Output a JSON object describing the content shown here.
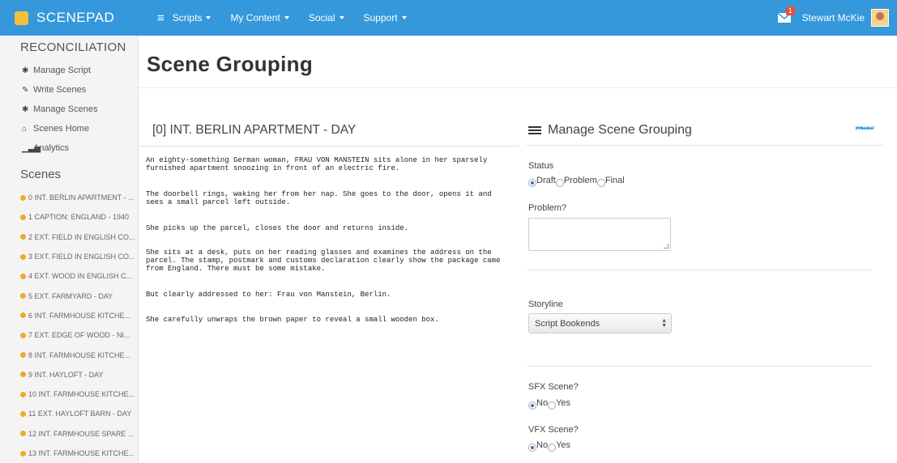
{
  "brand": {
    "name": "SCENEPAD"
  },
  "nav": {
    "menu_items": [
      "Scripts",
      "My Content",
      "Social",
      "Support"
    ],
    "mail_badge": "1",
    "user_name": "Stewart McKie"
  },
  "sidebar": {
    "heading": "RECONCILIATION",
    "links": [
      "Manage Script",
      "Write Scenes",
      "Manage Scenes",
      "Scenes Home",
      "Analytics"
    ],
    "scenes_heading": "Scenes",
    "scenes": [
      "0 INT. BERLIN APARTMENT - ...",
      "1 CAPTION: ENGLAND - 1940",
      "2 EXT. FIELD IN ENGLISH CO...",
      "3 EXT. FIELD IN ENGLISH CO...",
      "4 EXT. WOOD IN ENGLISH C...",
      "5 EXT. FARMYARD - DAY",
      "6 INT. FARMHOUSE KITCHE...",
      "7 EXT. EDGE OF WOOD - NI...",
      "8 INT. FARMHOUSE KITCHE...",
      "9 INT. HAYLOFT - DAY",
      "10 INT. FARMHOUSE KITCHE...",
      "11 EXT. HAYLOFT BARN - DAY",
      "12 INT. FARMHOUSE SPARE ...",
      "13 INT. FARMHOUSE KITCHE..."
    ]
  },
  "main": {
    "page_title": "Scene Grouping",
    "scene_heading": "[0] INT. BERLIN APARTMENT - DAY",
    "paragraphs": [
      "An eighty-something German woman, FRAU VON MANSTEIN sits alone in her sparsely\nfurnished apartment snoozing in front of an electric fire.",
      "The doorbell rings, waking her from her nap. She goes to the door, opens it and\nsees a small parcel left outside.",
      "She picks up the parcel, closes the door and returns inside.",
      "She sits at a desk, puts on her reading glasses and examines the address on the\nparcel. The stamp, postmark and customs declaration clearly show the package came\nfrom England. There must be some mistake.",
      "But clearly addressed to her: Frau von Manstein, Berlin.",
      "She carefully unwraps the brown paper to reveal a small wooden box."
    ]
  },
  "panel": {
    "title": "Manage Scene Grouping",
    "nav_glyphs": "⏮⏭⏭",
    "status_label": "Status",
    "status_options": [
      "Draft",
      "Problem",
      "Final"
    ],
    "status_selected": "Draft",
    "problem_label": "Problem?",
    "problem_value": "",
    "storyline_label": "Storyline",
    "storyline_value": "Script Bookends",
    "sfx_label": "SFX Scene?",
    "sfx_options": [
      "No",
      "Yes"
    ],
    "sfx_selected": "No",
    "vfx_label": "VFX Scene?",
    "vfx_options": [
      "No",
      "Yes"
    ],
    "vfx_selected": "No"
  },
  "colors": {
    "nav_bg": "#3498db",
    "accent_dot": "#f2a926",
    "badge": "#e74c3c"
  }
}
